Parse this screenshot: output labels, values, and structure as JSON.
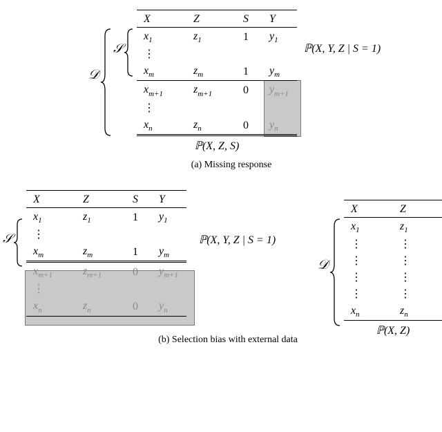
{
  "common": {
    "header": {
      "X": "X",
      "Z": "Z",
      "S": "S",
      "Y": "Y"
    },
    "rows": {
      "x1": "x",
      "z1": "z",
      "s1": "1",
      "y1": "y",
      "vdots": "⋮",
      "xm": "x",
      "zm": "z",
      "sm": "1",
      "ym": "y",
      "xm1": "x",
      "zm1": "z",
      "sm1": "0",
      "ym1": "y",
      "xn": "x",
      "zn": "z",
      "sn": "0",
      "yn": "y",
      "sub1": "1",
      "subm": "m",
      "subm1": "m+1",
      "subn": "n"
    },
    "labels": {
      "S": "𝒮",
      "D": "𝒟",
      "PXYZgS": "ℙ(X, Y, Z | S = 1)",
      "PXZS": "ℙ(X, Z, S)",
      "PXZ": "ℙ(X, Z)"
    }
  },
  "captions": {
    "a": "(a) Missing response",
    "b": "(b) Selection bias with external data"
  }
}
